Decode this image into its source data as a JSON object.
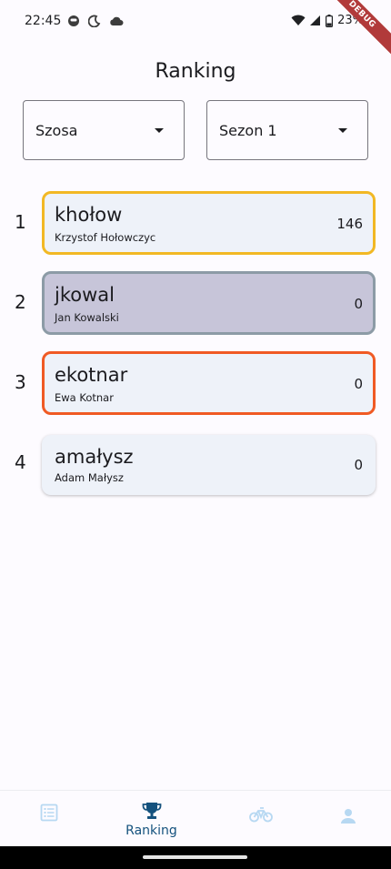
{
  "status_bar": {
    "time": "22:45",
    "battery": "23%",
    "icons": [
      "face-icon",
      "moon-icon",
      "cloud-icon",
      "wifi-icon",
      "signal-icon",
      "battery-icon"
    ]
  },
  "debug_banner": "DEBUG",
  "page": {
    "title": "Ranking"
  },
  "filters": {
    "discipline": "Szosa",
    "season": "Sezon 1"
  },
  "ranking": [
    {
      "rank": "1",
      "username": "khołow",
      "full_name": "Krzystof Hołowczyc",
      "points": "146",
      "border": "#f2b824",
      "fill": "#eef2f9"
    },
    {
      "rank": "2",
      "username": "jkowal",
      "full_name": "Jan Kowalski",
      "points": "0",
      "border": "#8c9ba6",
      "fill": "#c7c5d9"
    },
    {
      "rank": "3",
      "username": "ekotnar",
      "full_name": "Ewa Kotnar",
      "points": "0",
      "border": "#f05a24",
      "fill": "#eef2f9"
    },
    {
      "rank": "4",
      "username": "amałysz",
      "full_name": "Adam Małysz",
      "points": "0",
      "border": "",
      "fill": "#eef2f9"
    }
  ],
  "bottom_nav": {
    "active_color": "#15527e",
    "inactive_color": "#b7d8f2",
    "items": [
      {
        "icon": "list-icon",
        "label": ""
      },
      {
        "icon": "trophy-icon",
        "label": "Ranking"
      },
      {
        "icon": "bicycle-icon",
        "label": ""
      },
      {
        "icon": "person-icon",
        "label": ""
      }
    ]
  }
}
